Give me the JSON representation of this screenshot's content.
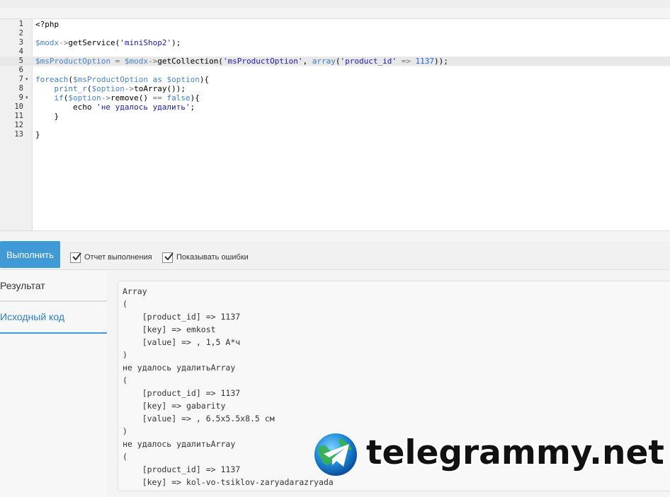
{
  "editor": {
    "lines": [
      {
        "n": "1",
        "tokens": [
          [
            "",
            "<?php"
          ]
        ]
      },
      {
        "n": "2",
        "tokens": []
      },
      {
        "n": "3",
        "tokens": [
          [
            "var",
            "$modx"
          ],
          [
            "op",
            "->"
          ],
          [
            "fn",
            "getService("
          ],
          [
            "str",
            "'miniShop2'"
          ],
          [
            "fn",
            ");"
          ]
        ]
      },
      {
        "n": "4",
        "tokens": []
      },
      {
        "n": "5",
        "active": true,
        "tokens": [
          [
            "var",
            "$msProductOption"
          ],
          [
            "op",
            " = "
          ],
          [
            "var",
            "$modx"
          ],
          [
            "op",
            "->"
          ],
          [
            "fn",
            "getCollection("
          ],
          [
            "str",
            "'msProductOption'"
          ],
          [
            "fn",
            ", "
          ],
          [
            "kw",
            "array"
          ],
          [
            "fn",
            "("
          ],
          [
            "str",
            "'product_id'"
          ],
          [
            "op",
            " => "
          ],
          [
            "num",
            "1137"
          ],
          [
            "fn",
            "));"
          ]
        ]
      },
      {
        "n": "6",
        "tokens": []
      },
      {
        "n": "7",
        "fold": true,
        "tokens": [
          [
            "kw",
            "foreach"
          ],
          [
            "fn",
            "("
          ],
          [
            "var",
            "$msProductOption"
          ],
          [
            "kw",
            " as "
          ],
          [
            "var",
            "$option"
          ],
          [
            "fn",
            "){"
          ]
        ]
      },
      {
        "n": "8",
        "tokens": [
          [
            "fn",
            "    "
          ],
          [
            "kw",
            "print_r"
          ],
          [
            "fn",
            "("
          ],
          [
            "var",
            "$option"
          ],
          [
            "op",
            "->"
          ],
          [
            "fn",
            "toArray());"
          ]
        ]
      },
      {
        "n": "9",
        "fold": true,
        "tokens": [
          [
            "fn",
            "    "
          ],
          [
            "kw",
            "if"
          ],
          [
            "fn",
            "("
          ],
          [
            "var",
            "$option"
          ],
          [
            "op",
            "->"
          ],
          [
            "fn",
            "remove() "
          ],
          [
            "op",
            "=="
          ],
          [
            "kw",
            " false"
          ],
          [
            "fn",
            "){"
          ]
        ]
      },
      {
        "n": "10",
        "tokens": [
          [
            "fn",
            "        echo "
          ],
          [
            "str",
            "'не удалось удалить'"
          ],
          [
            "fn",
            ";"
          ]
        ]
      },
      {
        "n": "11",
        "tokens": [
          [
            "fn",
            "    }"
          ]
        ]
      },
      {
        "n": "12",
        "tokens": []
      },
      {
        "n": "13",
        "tokens": [
          [
            "fn",
            "}"
          ]
        ]
      }
    ]
  },
  "toolbar": {
    "run_label": "Выполнить",
    "report_label": "Отчет выполнения",
    "errors_label": "Показывать ошибки"
  },
  "tabs": {
    "result": "Результат",
    "source": "Исходный код"
  },
  "output": {
    "lines": [
      "Array",
      "(",
      "    [product_id] => 1137",
      "    [key] => emkost",
      "    [value] => , 1,5 А*ч",
      ")",
      "не удалось удалитьArray",
      "(",
      "    [product_id] => 1137",
      "    [key] => gabarity",
      "    [value] => , 6.5x5.5x8.5 см",
      ")",
      "не удалось удалитьArray",
      "(",
      "    [product_id] => 1137",
      "    [key] => kol-vo-tsiklov-zaryadarazryada"
    ]
  },
  "watermark": {
    "text": "telegrammy.net"
  },
  "colors": {
    "accent": "#3f9ad6",
    "tab_active": "#2b7fc3"
  }
}
